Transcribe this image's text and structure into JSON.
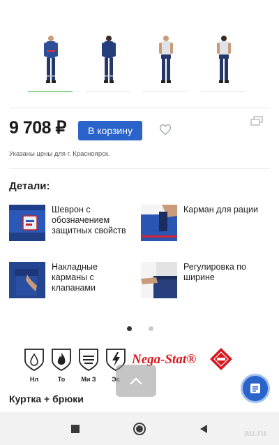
{
  "product": {
    "thumbnails": [
      {
        "label": "thumb-front-jacket",
        "active": true
      },
      {
        "label": "thumb-back-jacket",
        "active": false
      },
      {
        "label": "thumb-front-shirt",
        "active": false
      },
      {
        "label": "thumb-back-shirt",
        "active": false
      }
    ],
    "price": "9 708 ₽",
    "cart_button": "В корзину",
    "price_note": "Указаны цены для г. Красноярск."
  },
  "details": {
    "title": "Детали:",
    "features": [
      {
        "label": "Шеврон с обозначением защитных свойств"
      },
      {
        "label": "Карман для рации"
      },
      {
        "label": "Накладные карманы с клапанами"
      },
      {
        "label": "Регулировка по ширине"
      }
    ],
    "carousel": {
      "active_index": 0,
      "count": 2
    }
  },
  "certifications": [
    {
      "code": "Нл",
      "icon": "shield-oil-drop-icon"
    },
    {
      "code": "То",
      "icon": "shield-flame-icon"
    },
    {
      "code": "Ми З",
      "icon": "shield-abrasion-icon"
    },
    {
      "code": "Эс",
      "icon": "shield-static-icon"
    }
  ],
  "brand": {
    "name": "Nega-Stat®"
  },
  "set_title": "Куртка + брюки",
  "watermark": "au.ru",
  "colors": {
    "accent": "#2a63c9",
    "brand_red": "#d8181e",
    "active_thumb": "#8fd08f"
  }
}
